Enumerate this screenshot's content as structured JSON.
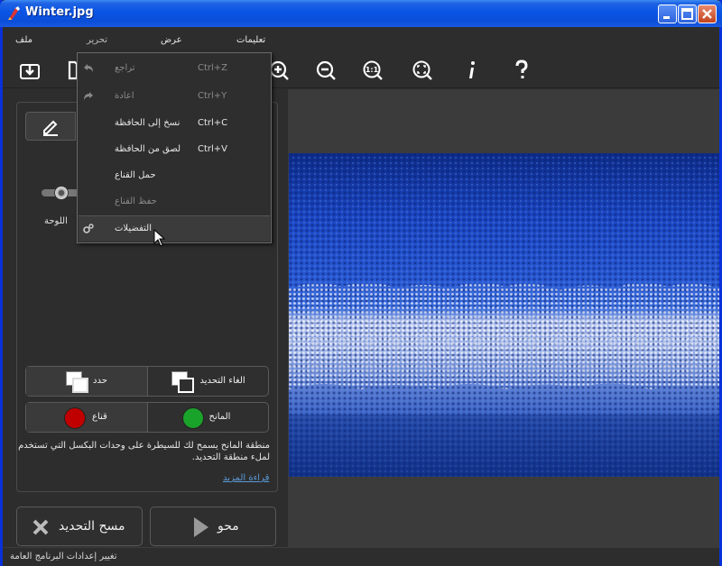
{
  "window": {
    "title": "Winter.jpg"
  },
  "menu": {
    "file": "ملف",
    "edit": "تحرير",
    "view": "عرض",
    "help": "تعليمات"
  },
  "edit_menu": {
    "items": [
      {
        "label": "تراجع",
        "shortcut": "Ctrl+Z",
        "enabled": false,
        "icon": "undo-icon"
      },
      {
        "label": "اعادة",
        "shortcut": "Ctrl+Y",
        "enabled": false,
        "icon": "redo-icon"
      },
      {
        "label": "نسخ إلى الحافظة",
        "shortcut": "Ctrl+C",
        "enabled": true
      },
      {
        "label": "لصق من الحافظة",
        "shortcut": "Ctrl+V",
        "enabled": true
      },
      {
        "label": "حمل القناع",
        "shortcut": "",
        "enabled": true
      },
      {
        "label": "حفظ القناع",
        "shortcut": "",
        "enabled": false
      },
      {
        "label": "التفضيلات",
        "shortcut": "",
        "enabled": true,
        "icon": "gears-icon"
      }
    ]
  },
  "left_panel": {
    "brush_size_label": "اللوحة",
    "select_button": "حدد",
    "deselect_button": "الغاء التحديد",
    "mask_button": "قناع",
    "donor_button": "المانح",
    "mask_color": "#c00000",
    "donor_color": "#1aa32a",
    "help_text": "منطقة المانح يسمح لك للسيطرة على وحدات البكسل التي تستخدم لملء منطقة التحديد.",
    "help_link": "قراءة المزيد",
    "clear_selection_button": "مسح التحديد",
    "erase_button": "محو"
  },
  "status": {
    "text": "تغيير إعدادات البرنامج العامة"
  }
}
